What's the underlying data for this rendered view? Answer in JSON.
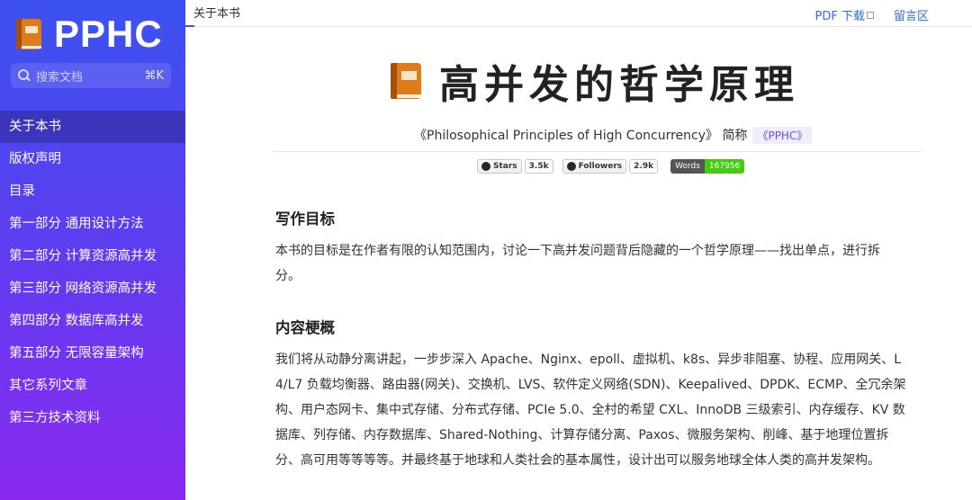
{
  "sidebar": {
    "brand": "PPHC",
    "search": {
      "placeholder": "搜索文档",
      "shortcut": "⌘K"
    },
    "items": [
      {
        "label": "关于本书",
        "active": true
      },
      {
        "label": "版权声明"
      },
      {
        "label": "目录"
      },
      {
        "label": "第一部分 通用设计方法"
      },
      {
        "label": "第二部分 计算资源高并发"
      },
      {
        "label": "第三部分 网络资源高并发"
      },
      {
        "label": "第四部分 数据库高并发"
      },
      {
        "label": "第五部分 无限容量架构"
      },
      {
        "label": "其它系列文章"
      },
      {
        "label": "第三方技术资料"
      }
    ]
  },
  "header": {
    "breadcrumb": "关于本书",
    "pdf_link": "PDF 下载",
    "comments_link": "留言区"
  },
  "main": {
    "title": "高并发的哲学原理",
    "subtitle_prefix": "《Philosophical Principles of High Concurrency》 简称",
    "subtitle_tag": "《PPHC》",
    "badges": {
      "stars_label": "Stars",
      "stars_count": "3.5k",
      "followers_label": "Followers",
      "followers_count": "2.9k",
      "words_label": "Words",
      "words_count": "167956"
    },
    "section1_title": "写作目标",
    "section1_line1": "本书的目标是在作者有限的认知范围内，讨论一下高并发问题背后隐藏的一个哲学原理——找出单点，进行拆",
    "section1_line2": "分。",
    "section2_title": "内容梗概",
    "section2_lines": [
      "我们将从动静分离讲起，一步步深入 Apache、Nginx、epoll、虚拟机、k8s、异步非阻塞、协程、应用网关、L",
      "4/L7 负载均衡器、路由器(网关)、交换机、LVS、软件定义网络(SDN)、Keepalived、DPDK、ECMP、全冗余架",
      "构、用户态网卡、集中式存储、分布式存储、PCIe 5.0、全村的希望 CXL、InnoDB 三级索引、内存缓存、KV 数",
      "据库、列存储、内存数据库、Shared-Nothing、计算存储分离、Paxos、微服务架构、削峰、基于地理位置拆",
      "分、高可用等等等等。并最终基于地球和人类社会的基本属性，设计出可以服务地球全体人类的高并发架构。"
    ]
  },
  "colors": {
    "sidebar_top": "#3b52f0",
    "sidebar_bottom": "#8a2af0",
    "link": "#2f6fde",
    "tag_text": "#6a4fd8",
    "words_badge": "#44cc11"
  },
  "icons": [
    "book-icon",
    "search-icon",
    "external-link-icon",
    "github-icon"
  ]
}
